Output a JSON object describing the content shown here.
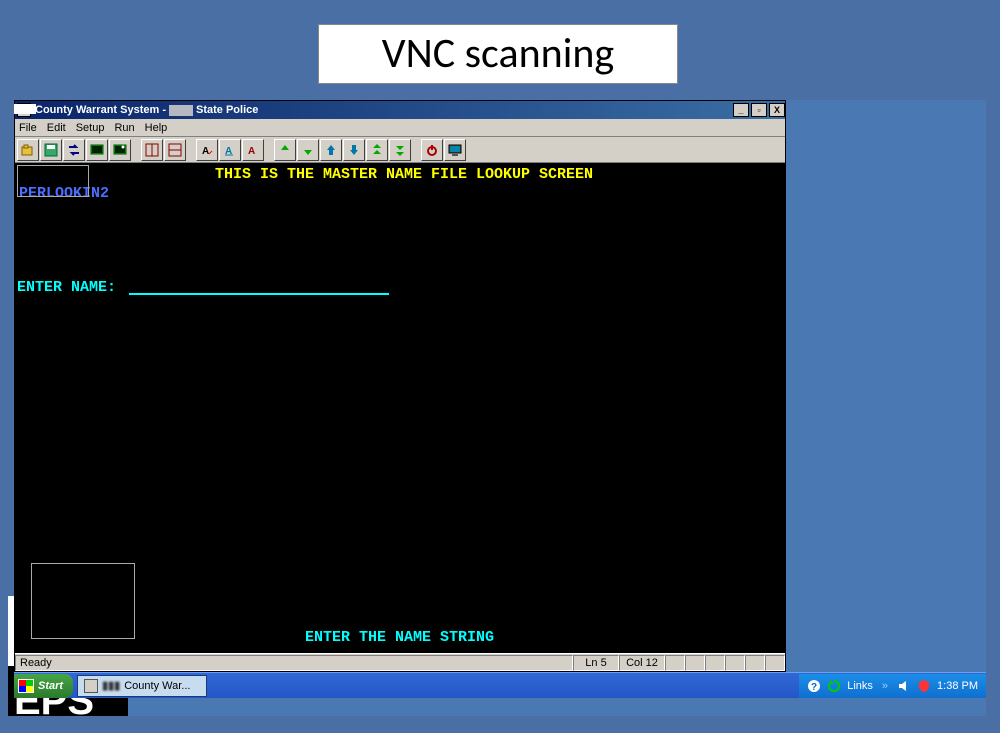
{
  "slide": {
    "title": "VNC scanning"
  },
  "window": {
    "title_prefix": "County Warrant System -",
    "title_suffix": "State Police",
    "controls": {
      "min": "_",
      "max": "▫",
      "close": "X"
    }
  },
  "menu": {
    "items": [
      "File",
      "Edit",
      "Setup",
      "Run",
      "Help"
    ]
  },
  "toolbar": {
    "groups": [
      [
        "open",
        "save",
        "swap",
        "screen-a",
        "screen-b"
      ],
      [
        "layout-a",
        "layout-b"
      ],
      [
        "font-a",
        "font-b",
        "font-c"
      ],
      [
        "arrow-up",
        "arrow-down",
        "arrow-up2",
        "arrow-down2",
        "arrow-up3",
        "arrow-down3"
      ],
      [
        "power",
        "monitor"
      ]
    ]
  },
  "terminal": {
    "header": "THIS IS THE MASTER NAME FILE LOOKUP SCREEN",
    "session": "PERLOOKIN2",
    "prompt": "ENTER NAME:",
    "footer": "ENTER THE NAME STRING"
  },
  "status": {
    "ready": "Ready",
    "ln": "Ln 5",
    "col": "Col 12"
  },
  "taskbar": {
    "start": "Start",
    "item_label": "County War...",
    "links_label": "Links",
    "clock": "1:38 PM"
  }
}
